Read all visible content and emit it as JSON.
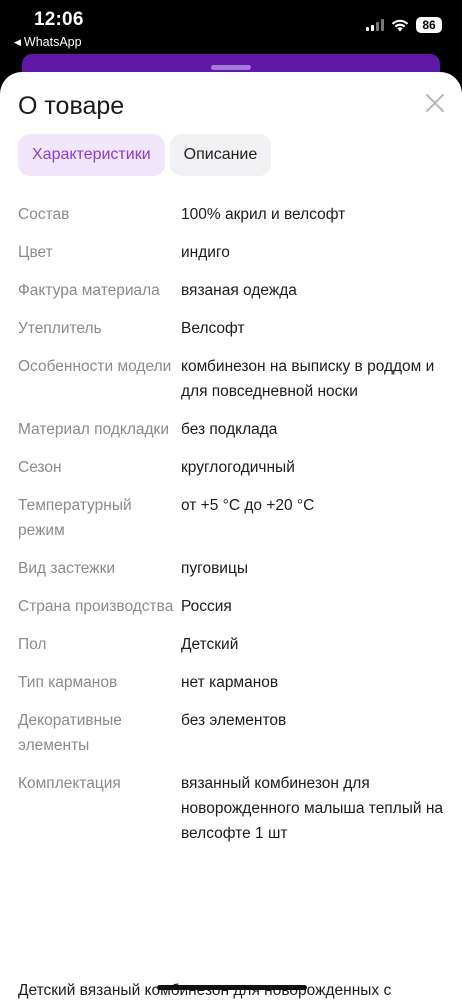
{
  "status": {
    "time": "12:06",
    "back_app": "WhatsApp",
    "battery": "86"
  },
  "sheet": {
    "title": "О товаре",
    "tabs": [
      {
        "label": "Характеристики",
        "active": true
      },
      {
        "label": "Описание",
        "active": false
      }
    ],
    "specs": [
      {
        "label": "Состав",
        "value": "100% акрил и велсофт"
      },
      {
        "label": "Цвет",
        "value": "индиго"
      },
      {
        "label": "Фактура материала",
        "value": "вязаная одежда"
      },
      {
        "label": "Утеплитель",
        "value": "Велсофт"
      },
      {
        "label": "Особенности модели",
        "value": "комбинезон на выписку в роддом и для повседневной носки"
      },
      {
        "label": "Материал подкладки",
        "value": "без подклада"
      },
      {
        "label": "Сезон",
        "value": "круглогодичный"
      },
      {
        "label": "Температурный режим",
        "value": "от +5 °C до +20 °C"
      },
      {
        "label": "Вид застежки",
        "value": "пуговицы"
      },
      {
        "label": "Страна производства",
        "value": "Россия"
      },
      {
        "label": "Пол",
        "value": "Детский"
      },
      {
        "label": "Тип карманов",
        "value": "нет карманов"
      },
      {
        "label": "Декоративные элементы",
        "value": "без элементов"
      },
      {
        "label": "Комплектация",
        "value": "вязанный комбинезон для новорожденного малыша теплый на велсофте 1 шт"
      }
    ],
    "description_preview": "Детский вязаный комбинезон для новорожденных с"
  },
  "colors": {
    "accent": "#8b3bd6",
    "accent_bg": "#f1e6fb",
    "brand_strip": "#5f17a6"
  },
  "icons": {
    "close": "close-icon",
    "back": "back-arrow-icon"
  }
}
